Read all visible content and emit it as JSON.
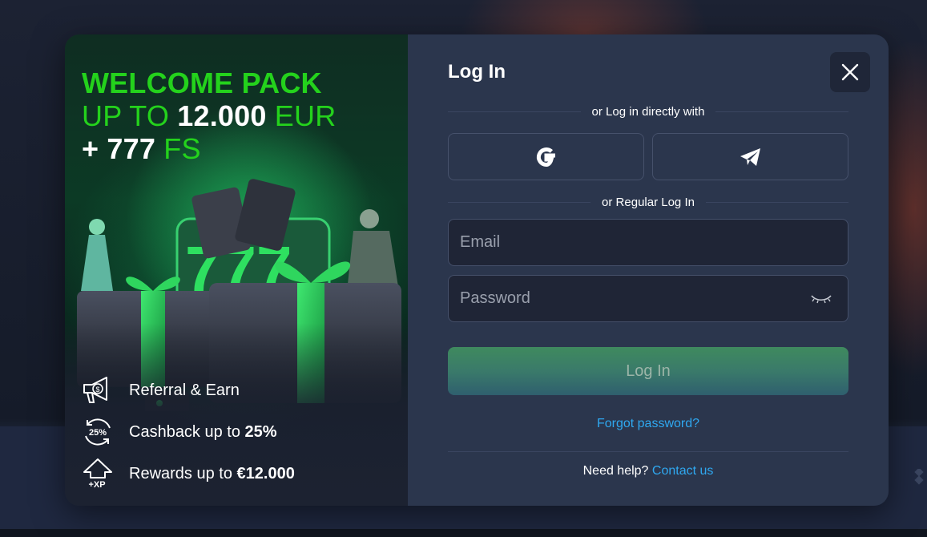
{
  "promo": {
    "title_line1": "WELCOME PACK",
    "title_line2_prefix": "UP TO ",
    "title_line2_amount": "12.000",
    "title_line2_suffix": " EUR",
    "title_line3_prefix": "+ 777",
    "title_line3_suffix": " FS",
    "features": [
      {
        "icon": "megaphone-dollar-icon",
        "text": "Referral & Earn",
        "bold": ""
      },
      {
        "icon": "cashback-25-icon",
        "icon_text": "25%",
        "text": "Cashback up to ",
        "bold": "25%"
      },
      {
        "icon": "xp-arrow-icon",
        "icon_text": "+XP",
        "text": "Rewards up to ",
        "bold": "€12.000"
      }
    ]
  },
  "login": {
    "title": "Log In",
    "direct_label": "or Log in directly with",
    "regular_label": "or Regular Log In",
    "email_placeholder": "Email",
    "password_placeholder": "Password",
    "submit_label": "Log In",
    "forgot_label": "Forgot password?",
    "help_text": "Need help?",
    "contact_label": "Contact us",
    "social": [
      "google-icon",
      "telegram-icon"
    ]
  },
  "colors": {
    "accent_green": "#24d21c",
    "link_blue": "#2fa8f0",
    "panel": "#2b364d"
  }
}
